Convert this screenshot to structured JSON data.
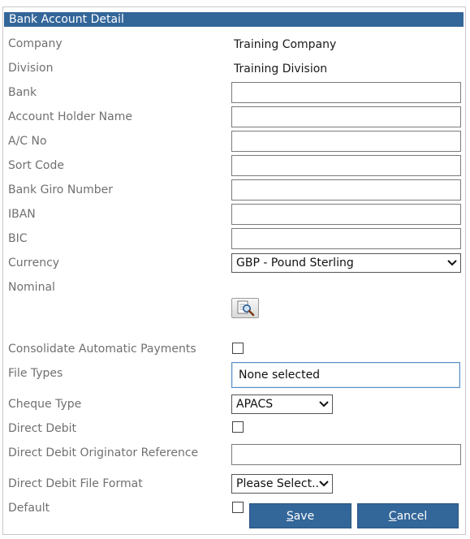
{
  "panel": {
    "title": "Bank Account Detail"
  },
  "form": {
    "company": {
      "label": "Company",
      "value": "Training Company"
    },
    "division": {
      "label": "Division",
      "value": "Training Division"
    },
    "bank": {
      "label": "Bank",
      "value": ""
    },
    "account_holder_name": {
      "label": "Account Holder Name",
      "value": ""
    },
    "ac_no": {
      "label": "A/C No",
      "value": ""
    },
    "sort_code": {
      "label": "Sort Code",
      "value": ""
    },
    "bank_giro_number": {
      "label": "Bank Giro Number",
      "value": ""
    },
    "iban": {
      "label": "IBAN",
      "value": ""
    },
    "bic": {
      "label": "BIC",
      "value": ""
    },
    "currency": {
      "label": "Currency",
      "selected": "GBP - Pound Sterling"
    },
    "nominal": {
      "label": "Nominal",
      "lookup_icon": "magnifier-lookup-icon"
    },
    "consolidate_automatic_payments": {
      "label": "Consolidate Automatic Payments",
      "checked": false
    },
    "file_types": {
      "label": "File Types",
      "selected": "None selected"
    },
    "cheque_type": {
      "label": "Cheque Type",
      "selected": "APACS"
    },
    "direct_debit": {
      "label": "Direct Debit",
      "checked": false
    },
    "direct_debit_originator_reference": {
      "label": "Direct Debit Originator Reference",
      "value": ""
    },
    "direct_debit_file_format": {
      "label": "Direct Debit File Format",
      "selected": "Please Select..."
    },
    "default": {
      "label": "Default",
      "checked": false
    }
  },
  "actions": {
    "save_first": "S",
    "save_rest": "ave",
    "cancel_first": "C",
    "cancel_rest": "ancel"
  },
  "colors": {
    "accent": "#336699",
    "label": "#707070",
    "focus_border": "#5b8fc7"
  }
}
